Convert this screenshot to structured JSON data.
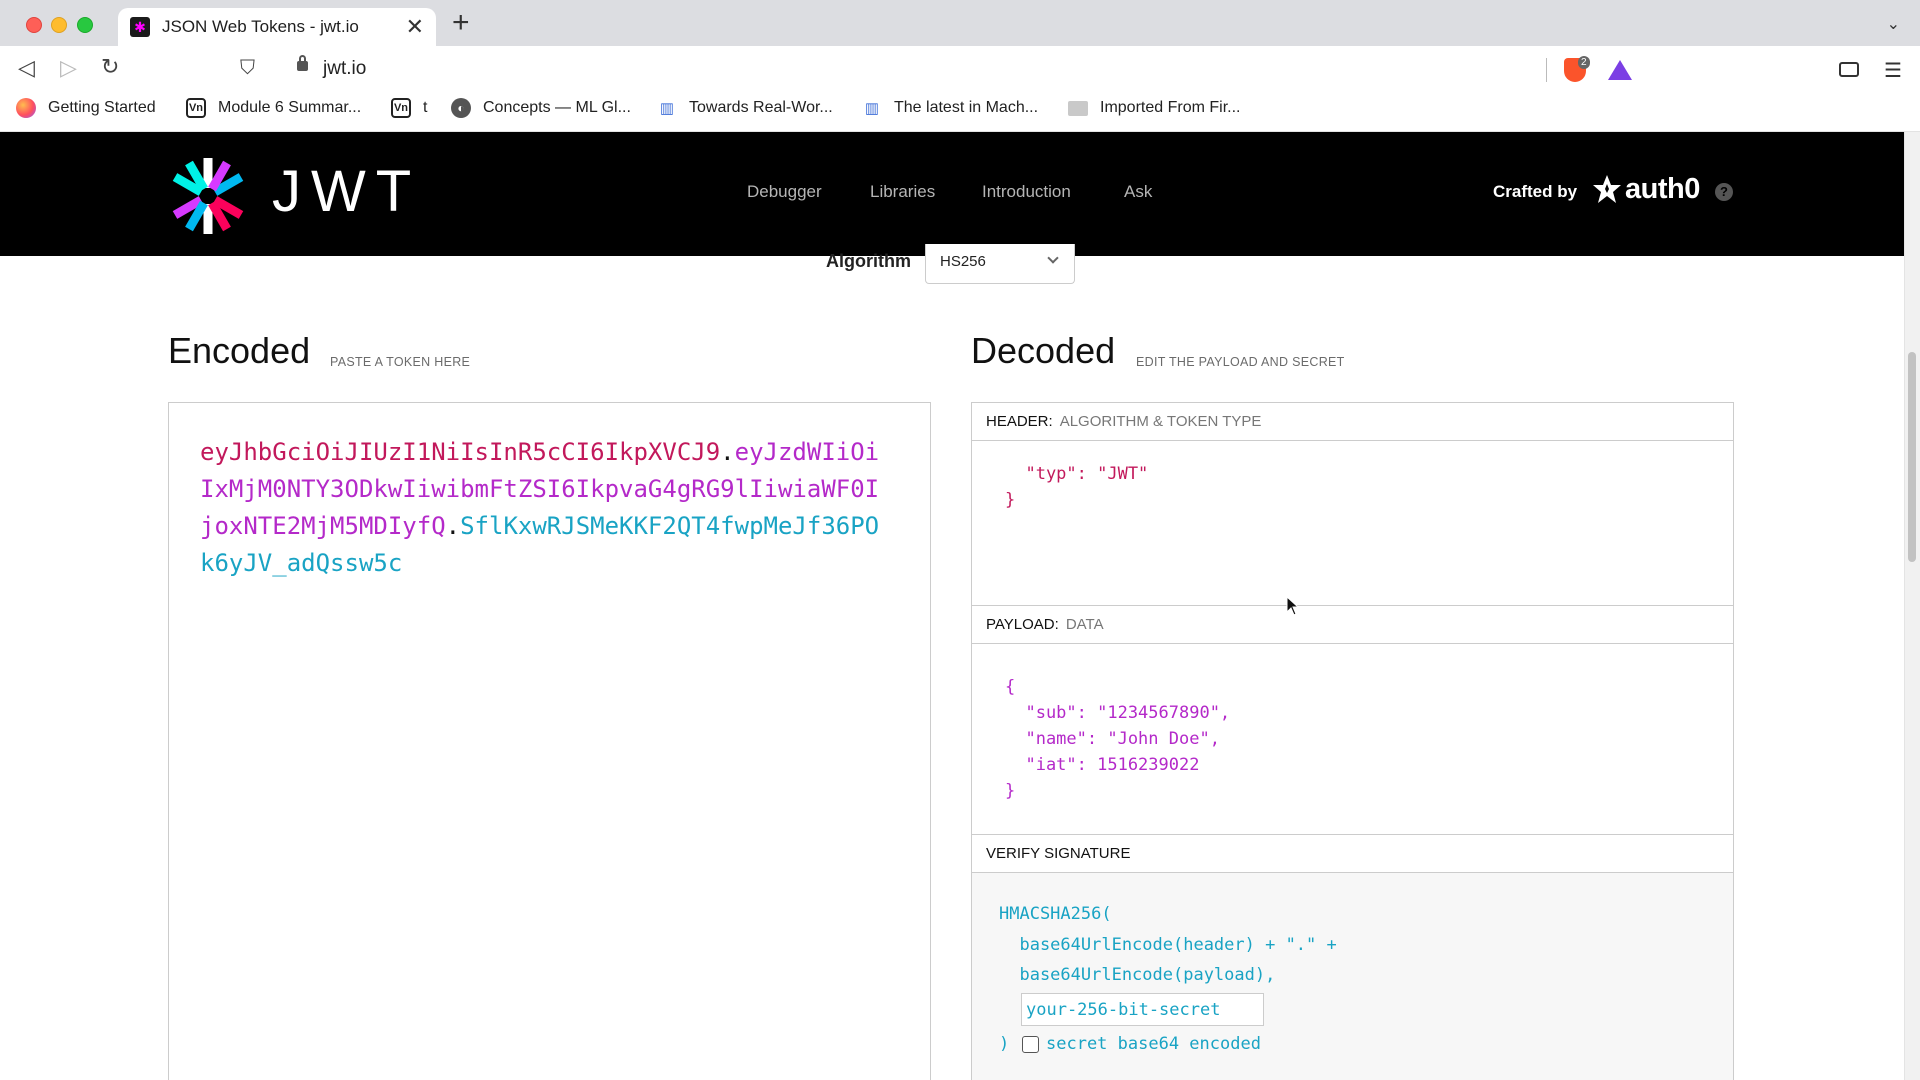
{
  "browser": {
    "tab_title": "JSON Web Tokens - jwt.io",
    "tab_close": "✕",
    "new_tab": "+",
    "url": "jwt.io",
    "shield_count": "2",
    "bookmarks": [
      {
        "label": "Getting Started",
        "icon": "firefox-icon"
      },
      {
        "label": "Module 6 Summar...",
        "icon": "vn-icon"
      },
      {
        "label": "t",
        "icon": "vn-icon"
      },
      {
        "label": "Concepts — ML Gl...",
        "icon": "globe-icon"
      },
      {
        "label": "Towards Real-Wor...",
        "icon": "blue-bars-icon"
      },
      {
        "label": "The latest in Mach...",
        "icon": "blue-bars-icon"
      },
      {
        "label": "Imported From Fir...",
        "icon": "folder-icon"
      }
    ]
  },
  "site": {
    "logo_text": "JWT",
    "nav": [
      "Debugger",
      "Libraries",
      "Introduction",
      "Ask"
    ],
    "crafted_by": "Crafted by",
    "auth0": "auth0",
    "help": "?"
  },
  "algorithm": {
    "label": "Algorithm",
    "value": "HS256"
  },
  "encoded": {
    "title": "Encoded",
    "subtitle": "PASTE A TOKEN HERE",
    "header_part": "eyJhbGciOiJIUzI1NiIsInR5cCI6IkpXVCJ9",
    "payload_part": "eyJzdWIiOiIxMjM0NTY3ODkwIiwibmFtZSI6IkpvaG4gRG9lIiwiaWF0IjoxNTE2MjM5MDIyfQ",
    "signature_part": "SflKxwRJSMeKKF2QT4fwpMeJf36POk6yJV_adQssw5c",
    "dot": "."
  },
  "decoded": {
    "title": "Decoded",
    "subtitle": "EDIT THE PAYLOAD AND SECRET",
    "header": {
      "label": "HEADER:",
      "desc": "ALGORITHM & TOKEN TYPE",
      "code": "  \"typ\": \"JWT\"\n}"
    },
    "payload": {
      "label": "PAYLOAD:",
      "desc": "DATA",
      "code": "{\n  \"sub\": \"1234567890\",\n  \"name\": \"John Doe\",\n  \"iat\": 1516239022\n}"
    },
    "signature": {
      "label": "VERIFY SIGNATURE",
      "code": "HMACSHA256(\n  base64UrlEncode(header) + \".\" +\n  base64UrlEncode(payload),",
      "secret_placeholder": "your-256-bit-secret",
      "close_paren": ")",
      "checkbox_label": "secret base64 encoded"
    }
  },
  "colors": {
    "header": "#c2185b",
    "payload": "#b429c9",
    "signature": "#19a3c4"
  }
}
